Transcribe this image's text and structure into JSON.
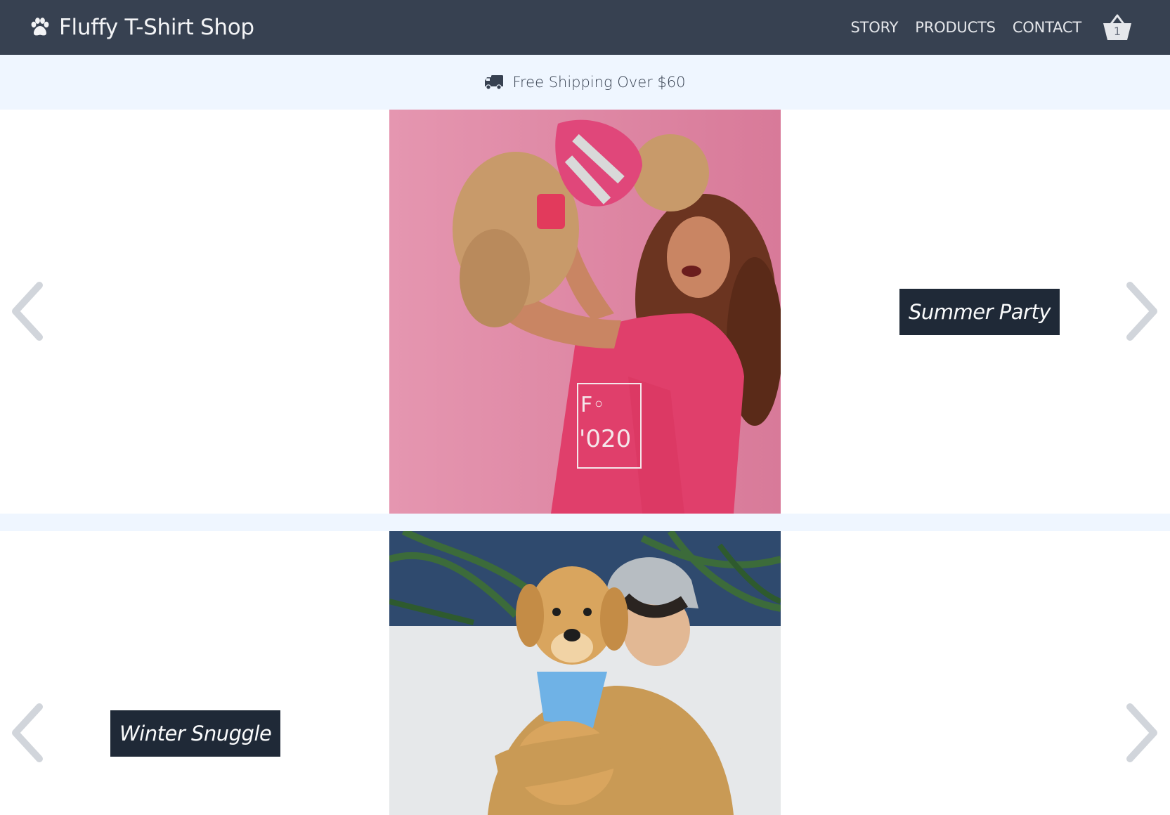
{
  "header": {
    "brand": "Fluffy T-Shirt Shop",
    "brand_icon": "paw-icon",
    "nav": [
      {
        "label": "STORY"
      },
      {
        "label": "PRODUCTS"
      },
      {
        "label": "CONTACT"
      }
    ],
    "cart": {
      "icon": "basket-icon",
      "count": "1"
    }
  },
  "shipping": {
    "icon": "truck-icon",
    "text": "Free Shipping Over $60"
  },
  "slides": [
    {
      "caption": "Summer Party",
      "photo": "woman-lifting-dog-pink-photo"
    },
    {
      "caption": "Winter Snuggle",
      "photo": "man-hugging-golden-retriever-photo"
    }
  ],
  "colors": {
    "header_bg": "#374151",
    "banner_bg": "#eff6ff",
    "caption_bg": "#1f2937",
    "arrow": "#d1d5db"
  }
}
